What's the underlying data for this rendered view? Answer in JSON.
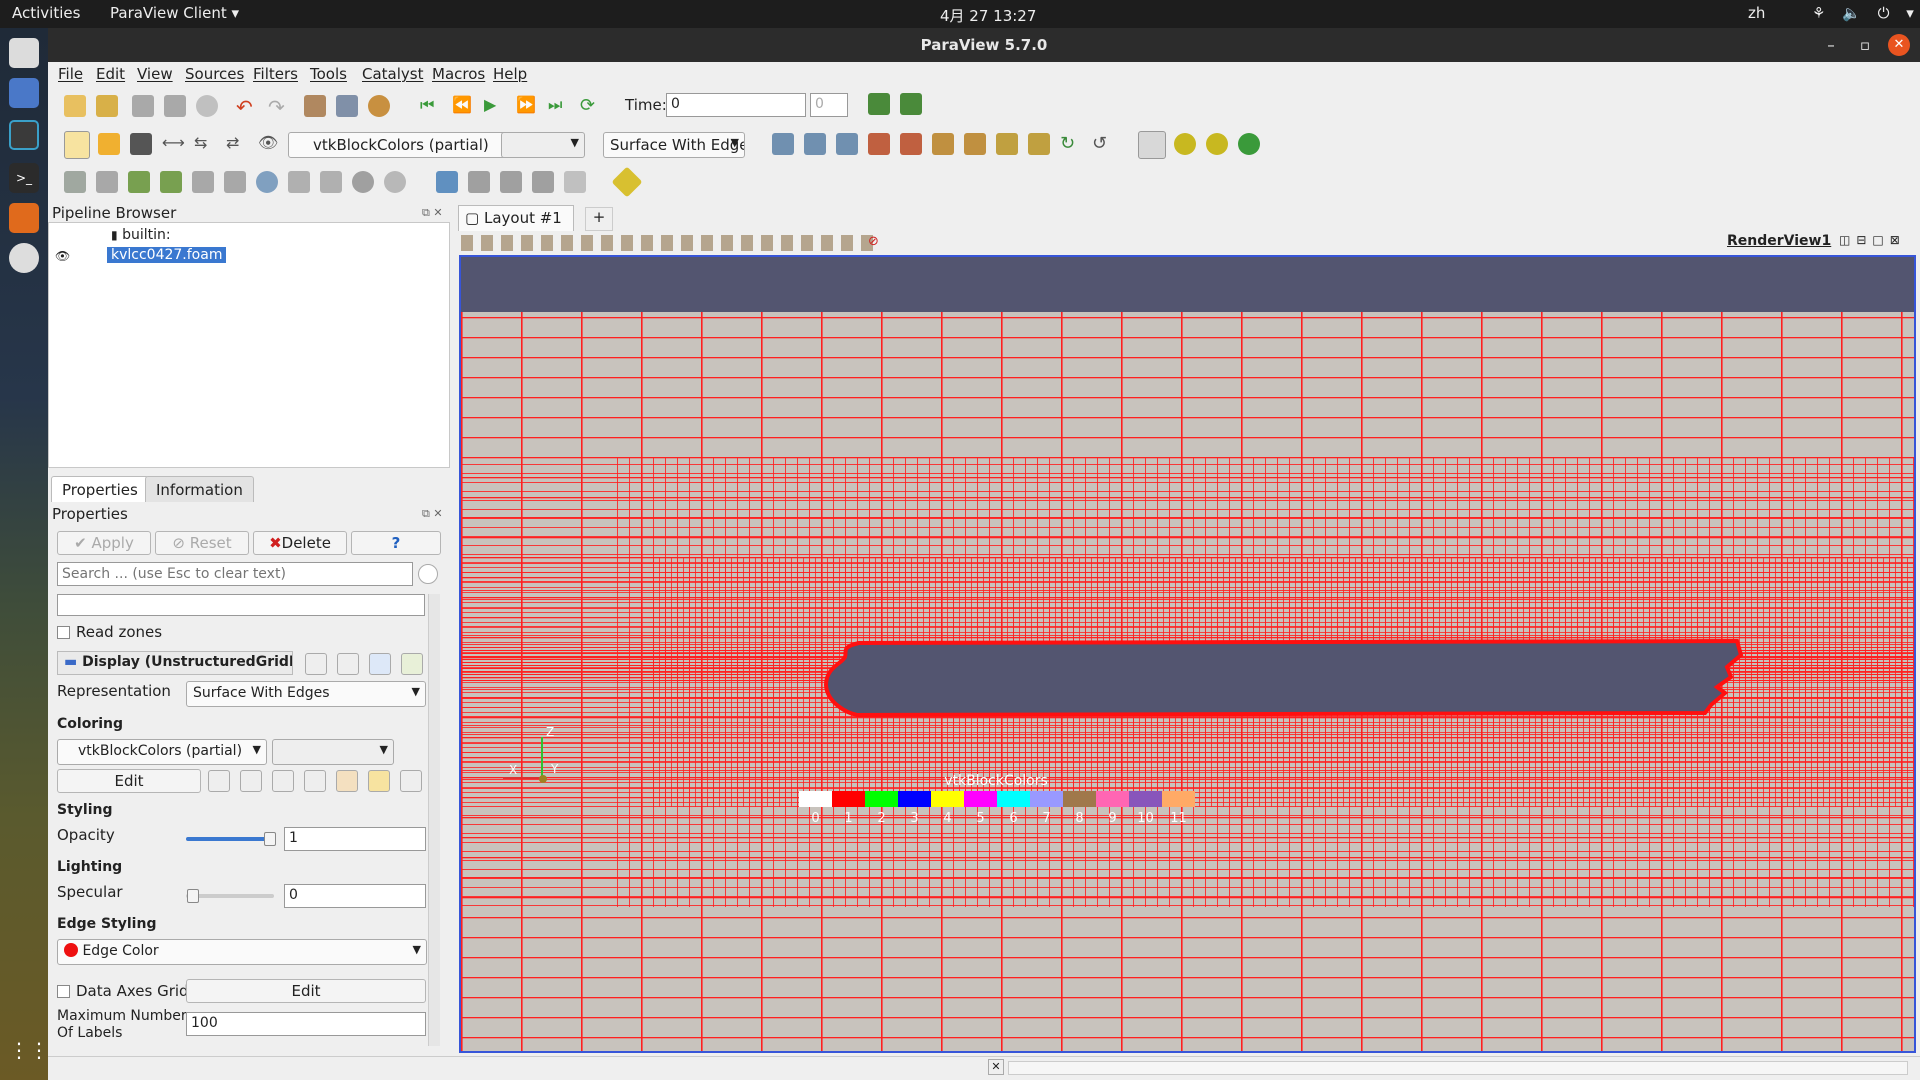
{
  "topbar": {
    "activities": "Activities",
    "app_menu": "ParaView Client",
    "clock": "4月 27  13:27",
    "lang": "zh"
  },
  "window": {
    "title": "ParaView 5.7.0"
  },
  "menu": [
    "File",
    "Edit",
    "View",
    "Sources",
    "Filters",
    "Tools",
    "Catalyst",
    "Macros",
    "Help"
  ],
  "toolbar": {
    "time_label": "Time:",
    "time_value": "0",
    "time_step": "0",
    "coloring_combo": "vtkBlockColors (partial)",
    "repr_combo": "Surface With Edge"
  },
  "pipeline": {
    "title": "Pipeline Browser",
    "root": "builtin:",
    "source": "kvlcc0427.foam"
  },
  "tabs": {
    "properties": "Properties",
    "information": "Information"
  },
  "props": {
    "header": "Properties",
    "apply": "Apply",
    "reset": "Reset",
    "delete": "Delete",
    "help": "?",
    "search_placeholder": "Search ... (use Esc to clear text)",
    "read_zones": "Read zones",
    "display": "Display (UnstructuredGridR",
    "representation_label": "Representation",
    "representation_value": "Surface With Edges",
    "coloring_section": "Coloring",
    "coloring_value": "vtkBlockColors (partial)",
    "edit": "Edit",
    "styling_section": "Styling",
    "opacity_label": "Opacity",
    "opacity_value": "1",
    "lighting_section": "Lighting",
    "specular_label": "Specular",
    "specular_value": "0",
    "edge_section": "Edge Styling",
    "edge_color": "Edge Color",
    "data_axes_grid": "Data Axes Grid",
    "data_axes_edit": "Edit",
    "max_labels_label1": "Maximum Number",
    "max_labels_label2": "Of Labels",
    "max_labels_value": "100"
  },
  "layout": {
    "tab": "Layout #1",
    "add": "+",
    "view_name": "RenderView1"
  },
  "legend": {
    "title": "vtkBlockColors",
    "entries": [
      {
        "label": "0",
        "color": "#ffffff"
      },
      {
        "label": "1",
        "color": "#ff0000"
      },
      {
        "label": "2",
        "color": "#00ff00"
      },
      {
        "label": "3",
        "color": "#0000ff"
      },
      {
        "label": "4",
        "color": "#ffff00"
      },
      {
        "label": "5",
        "color": "#ff00ff"
      },
      {
        "label": "6",
        "color": "#00ffff"
      },
      {
        "label": "7",
        "color": "#9999ff"
      },
      {
        "label": "8",
        "color": "#a0784b"
      },
      {
        "label": "9",
        "color": "#ff66b3"
      },
      {
        "label": "10",
        "color": "#8855bb"
      },
      {
        "label": "11",
        "color": "#ffaa66"
      }
    ]
  },
  "axes": {
    "z": "Z",
    "y": "Y",
    "x": "X"
  },
  "colors": {
    "mesh": "#ff2020",
    "background": "#c8c3bd",
    "sky": "#535570",
    "accent": "#3755d8"
  }
}
